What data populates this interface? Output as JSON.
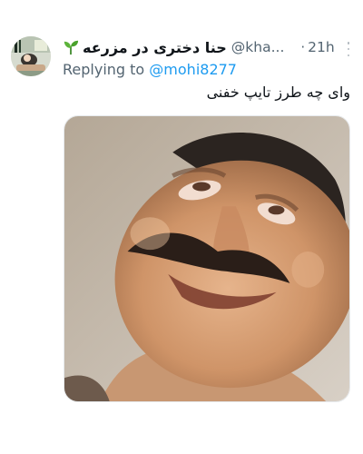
{
  "tweet": {
    "avatar_icon": "profile-avatar",
    "badge_icon": "sprout-icon",
    "display_name": "حنا دختری در مزرعه",
    "handle": "@kha...",
    "separator": "·",
    "time": "21h",
    "more_icon": "more-options-icon",
    "replying_prefix": "Replying to",
    "replying_to": "@mohi8277",
    "text": "وای چه طرز  تایپ خفنی",
    "media_icon": "meme-face-image"
  },
  "colors": {
    "text_primary": "#0f1419",
    "text_secondary": "#536471",
    "link": "#1d9bf0"
  }
}
